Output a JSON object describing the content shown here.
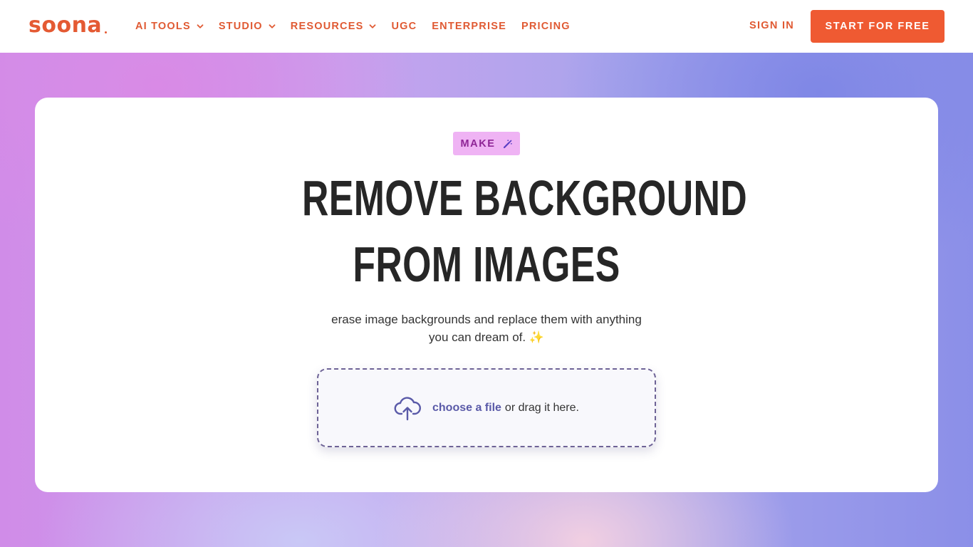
{
  "brand": {
    "logo": "soona",
    "accent": "#ef5a32",
    "nav_text_color": "#e05a33"
  },
  "nav": {
    "items": [
      {
        "label": "AI TOOLS",
        "has_dropdown": true
      },
      {
        "label": "STUDIO",
        "has_dropdown": true
      },
      {
        "label": "RESOURCES",
        "has_dropdown": true
      },
      {
        "label": "UGC",
        "has_dropdown": false
      },
      {
        "label": "ENTERPRISE",
        "has_dropdown": false
      },
      {
        "label": "PRICING",
        "has_dropdown": false
      }
    ],
    "sign_in": "SIGN IN",
    "cta": "START FOR FREE"
  },
  "hero": {
    "tag": "MAKE",
    "tag_icon": "magic-wand-icon",
    "title_line1": "REMOVE BACKGROUND",
    "title_line2": "FROM IMAGES",
    "subtitle_line1": "erase image backgrounds and replace them with anything",
    "subtitle_line2": "you can dream of. ✨"
  },
  "dropzone": {
    "icon": "cloud-upload-icon",
    "choose_label": "choose a file",
    "drag_label": "or drag it here."
  }
}
